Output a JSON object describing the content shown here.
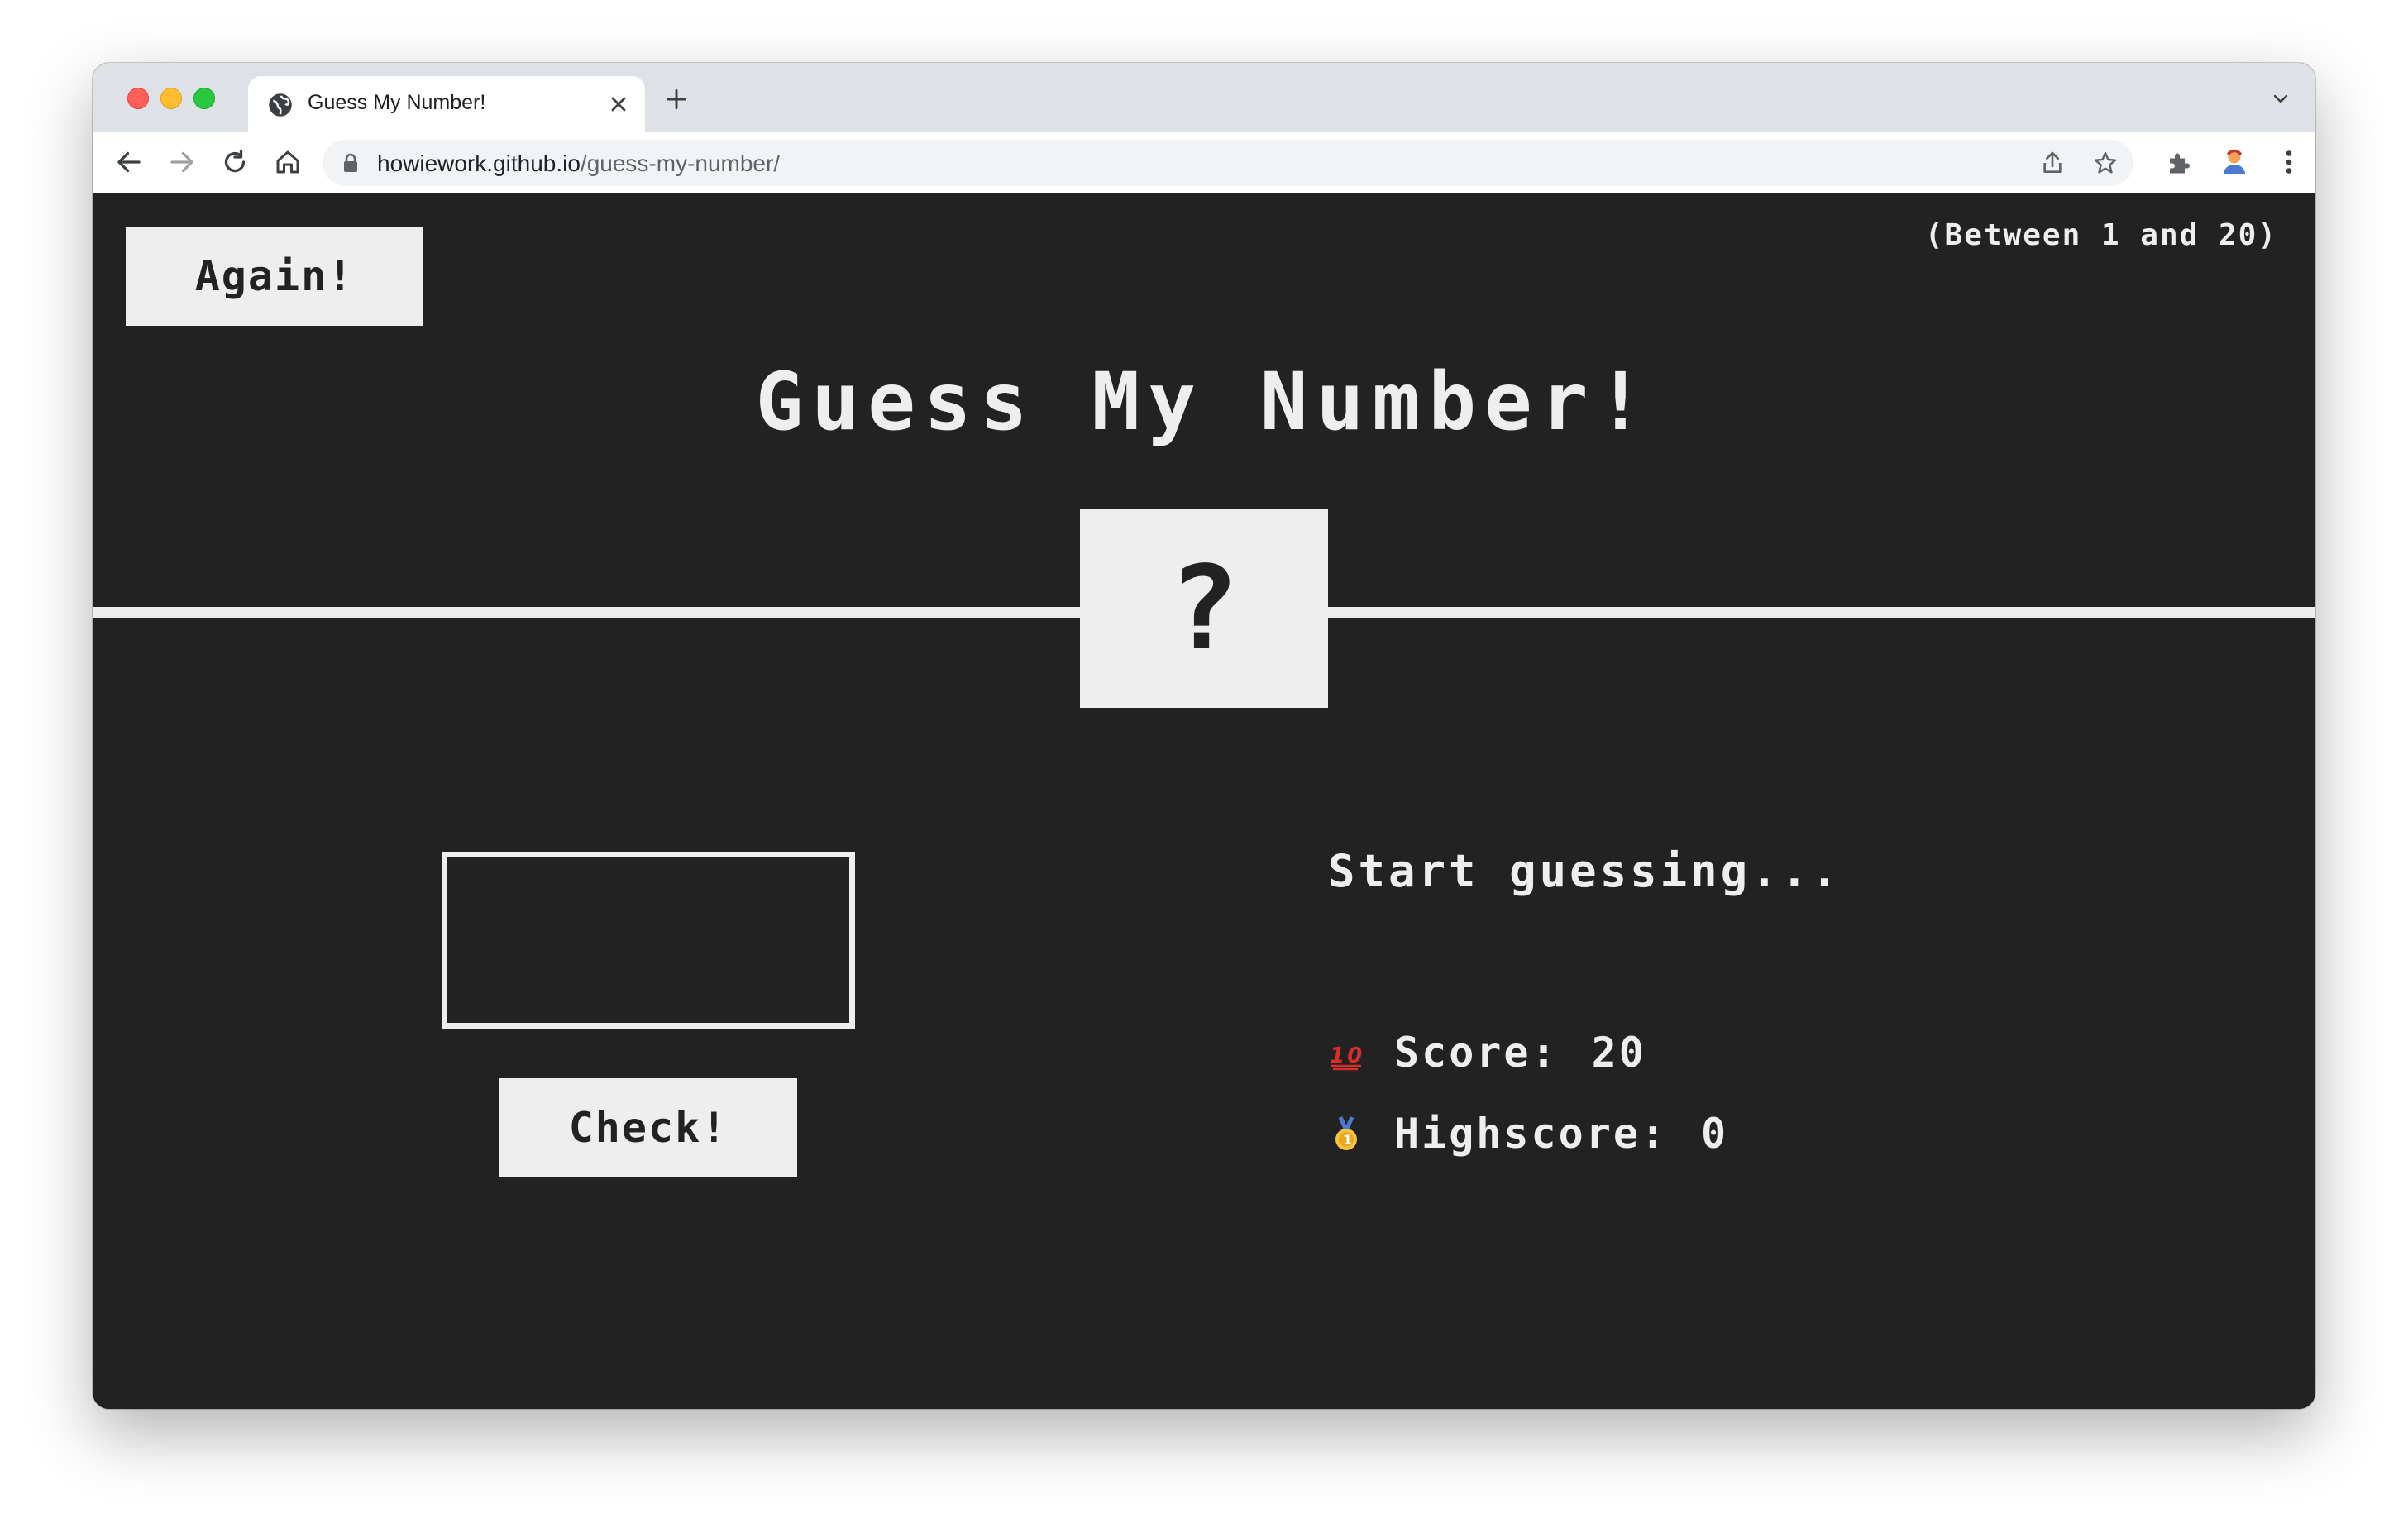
{
  "browser": {
    "tab_title": "Guess My Number!",
    "url_domain": "howiework.github.io",
    "url_path": "/guess-my-number/"
  },
  "game": {
    "again_label": "Again!",
    "range_hint": "(Between 1 and 20)",
    "title": "Guess My Number!",
    "secret_number": "?",
    "guess_value": "",
    "check_label": "Check!",
    "message": "Start guessing...",
    "score_label": "Score:",
    "score_value": "20",
    "highscore_label": "Highscore:",
    "highscore_value": "0",
    "score_icon": "hundred-points-emoji",
    "highscore_icon": "medal-emoji"
  },
  "colors": {
    "background": "#222222",
    "foreground": "#eeeeee"
  }
}
